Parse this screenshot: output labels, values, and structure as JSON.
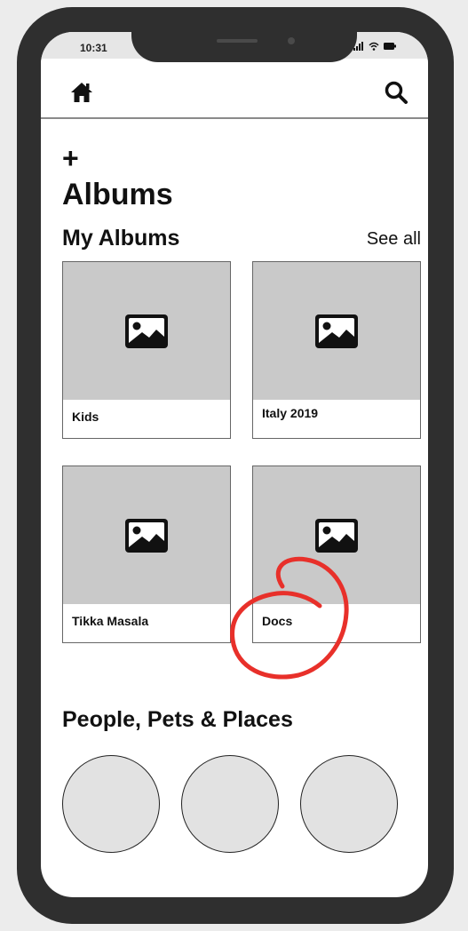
{
  "status_bar": {
    "time": "10:31",
    "signal_icon": "signal-bars-icon",
    "wifi_icon": "wifi-icon",
    "battery_icon": "battery-icon"
  },
  "nav": {
    "home_icon": "home-icon",
    "search_icon": "search-icon"
  },
  "page": {
    "add_label": "+",
    "title": "Albums"
  },
  "my_albums": {
    "title": "My Albums",
    "see_all": "See all",
    "items": [
      {
        "label": "Kids",
        "icon": "image-icon"
      },
      {
        "label": "Italy 2019",
        "icon": "image-icon"
      },
      {
        "label": "Tikka Masala",
        "icon": "image-icon"
      },
      {
        "label": "Docs",
        "icon": "image-icon"
      }
    ]
  },
  "people": {
    "title": "People, Pets & Places",
    "count": 3
  },
  "colors": {
    "phone_frame": "#2f2f2f",
    "thumbnail": "#c9c9c9",
    "avatar_fill": "#e2e2e2",
    "annotation": "#e8302a"
  }
}
